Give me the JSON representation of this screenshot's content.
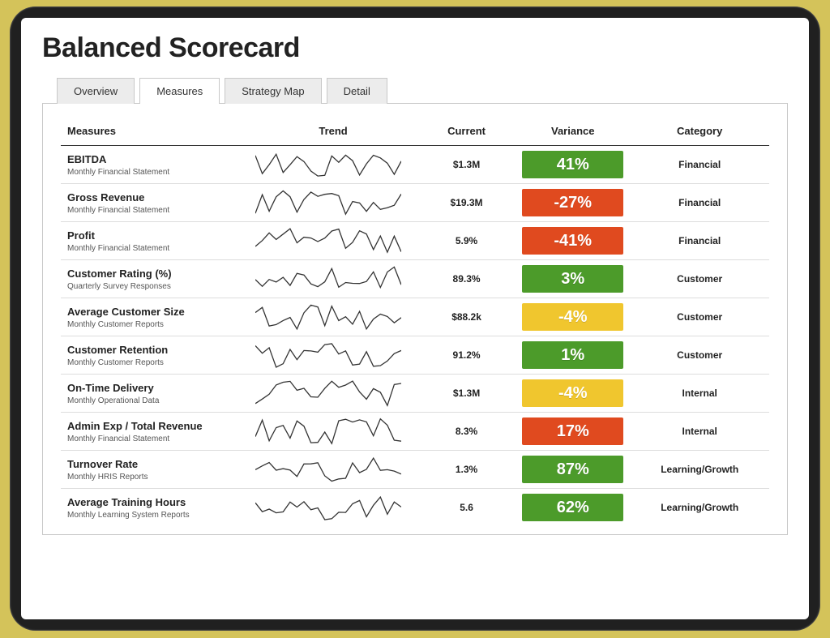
{
  "title": "Balanced Scorecard",
  "tabs": [
    {
      "label": "Overview",
      "active": false
    },
    {
      "label": "Measures",
      "active": true
    },
    {
      "label": "Strategy Map",
      "active": false
    },
    {
      "label": "Detail",
      "active": false
    }
  ],
  "columns": {
    "measures": "Measures",
    "trend": "Trend",
    "current": "Current",
    "variance": "Variance",
    "category": "Category"
  },
  "variance_colors": {
    "green": "#4c9b2a",
    "red": "#e04a1f",
    "yellow": "#f0c62e"
  },
  "rows": [
    {
      "name": "EBITDA",
      "source": "Monthly Financial Statement",
      "current": "$1.3M",
      "variance": "41%",
      "variance_color": "green",
      "category": "Financial"
    },
    {
      "name": "Gross Revenue",
      "source": "Monthly Financial Statement",
      "current": "$19.3M",
      "variance": "-27%",
      "variance_color": "red",
      "category": "Financial"
    },
    {
      "name": "Profit",
      "source": "Monthly Financial Statement",
      "current": "5.9%",
      "variance": "-41%",
      "variance_color": "red",
      "category": "Financial"
    },
    {
      "name": "Customer Rating (%)",
      "source": "Quarterly Survey Responses",
      "current": "89.3%",
      "variance": "3%",
      "variance_color": "green",
      "category": "Customer"
    },
    {
      "name": "Average Customer Size",
      "source": "Monthly Customer Reports",
      "current": "$88.2k",
      "variance": "-4%",
      "variance_color": "yellow",
      "category": "Customer"
    },
    {
      "name": "Customer Retention",
      "source": "Monthly Customer Reports",
      "current": "91.2%",
      "variance": "1%",
      "variance_color": "green",
      "category": "Customer"
    },
    {
      "name": "On-Time Delivery",
      "source": "Monthly Operational Data",
      "current": "$1.3M",
      "variance": "-4%",
      "variance_color": "yellow",
      "category": "Internal"
    },
    {
      "name": "Admin Exp / Total Revenue",
      "source": "Monthly Financial Statement",
      "current": "8.3%",
      "variance": "17%",
      "variance_color": "red",
      "category": "Internal"
    },
    {
      "name": "Turnover Rate",
      "source": "Monthly HRIS Reports",
      "current": "1.3%",
      "variance": "87%",
      "variance_color": "green",
      "category": "Learning/Growth"
    },
    {
      "name": "Average Training Hours",
      "source": "Monthly Learning System Reports",
      "current": "5.6",
      "variance": "62%",
      "variance_color": "green",
      "category": "Learning/Growth"
    }
  ]
}
